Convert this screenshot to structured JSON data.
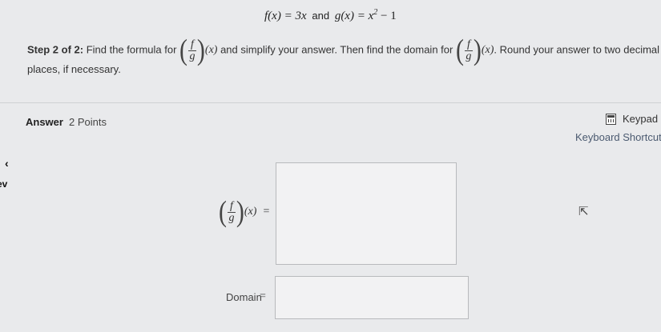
{
  "functions": {
    "f_def": "f(x) = 3x",
    "and": "and",
    "g_def": "g(x) = x"
  },
  "g_exponent": "2",
  "g_tail": " − 1",
  "step": {
    "label": "Step 2 of 2:",
    "text_1": " Find the formula for ",
    "text_2": " and simplify your answer. Then find the domain for ",
    "text_3": ". Round your answer to two decimal places, if necessary."
  },
  "frac": {
    "num": "f",
    "den": "g",
    "arg": "(x)"
  },
  "answer": {
    "label": "Answer",
    "points": "2 Points"
  },
  "keypad": {
    "label": "Keypad"
  },
  "shortcuts": {
    "label": "Keyboard Shortcuts"
  },
  "nav": {
    "back": "‹",
    "prev": "ev"
  },
  "domain": {
    "label": "Domain",
    "equals": "="
  },
  "equals": "="
}
